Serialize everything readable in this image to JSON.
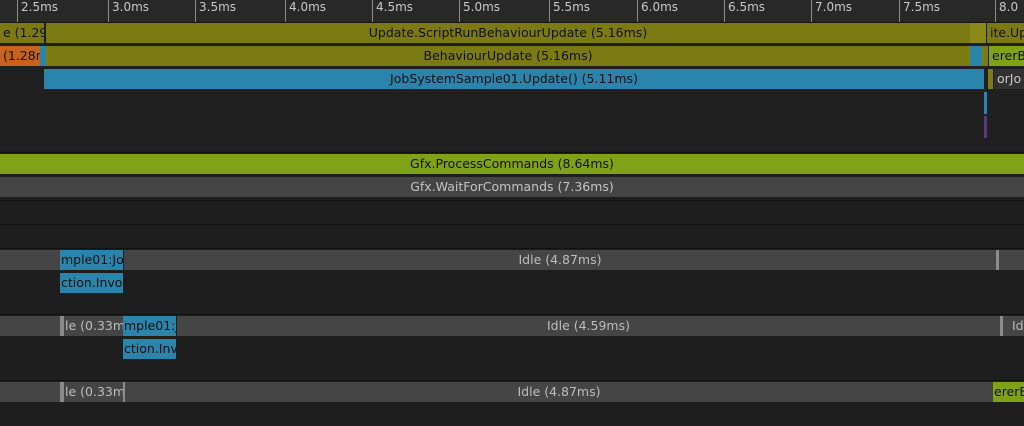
{
  "ruler": {
    "ticks": [
      "2.5ms",
      "3.0ms",
      "3.5ms",
      "4.0ms",
      "4.5ms",
      "5.0ms",
      "5.5ms",
      "6.0ms",
      "6.5ms",
      "7.0ms",
      "7.5ms",
      "8.0"
    ]
  },
  "main_thread": {
    "left_olive": "e (1.29",
    "script_run": "Update.ScriptRunBehaviourUpdate (5.16ms)",
    "right_olive": "ite.Up",
    "left_orange": "(1.28r",
    "behaviour_update": "BehaviourUpdate (5.16ms)",
    "right_green": "ererB",
    "job_update": "JobSystemSample01.Update() (5.11ms)",
    "right_job": "orJo"
  },
  "render_thread": {
    "process_commands": "Gfx.ProcessCommands (8.64ms)",
    "wait_for_commands": "Gfx.WaitForCommands (7.36ms)"
  },
  "worker1": {
    "job_label": "mple01:Jo",
    "action_label": "ction.Invo",
    "idle": "Idle (4.87ms)"
  },
  "worker2": {
    "left_idle": "le (0.33m",
    "job_label": "mple01:J",
    "action_label": "ction.Inv",
    "idle": "Idle (4.59ms)",
    "right_idle": "Id"
  },
  "worker3": {
    "left_idle": "le (0.33m",
    "idle": "Idle (4.87ms)",
    "right_green": "ererB"
  }
}
